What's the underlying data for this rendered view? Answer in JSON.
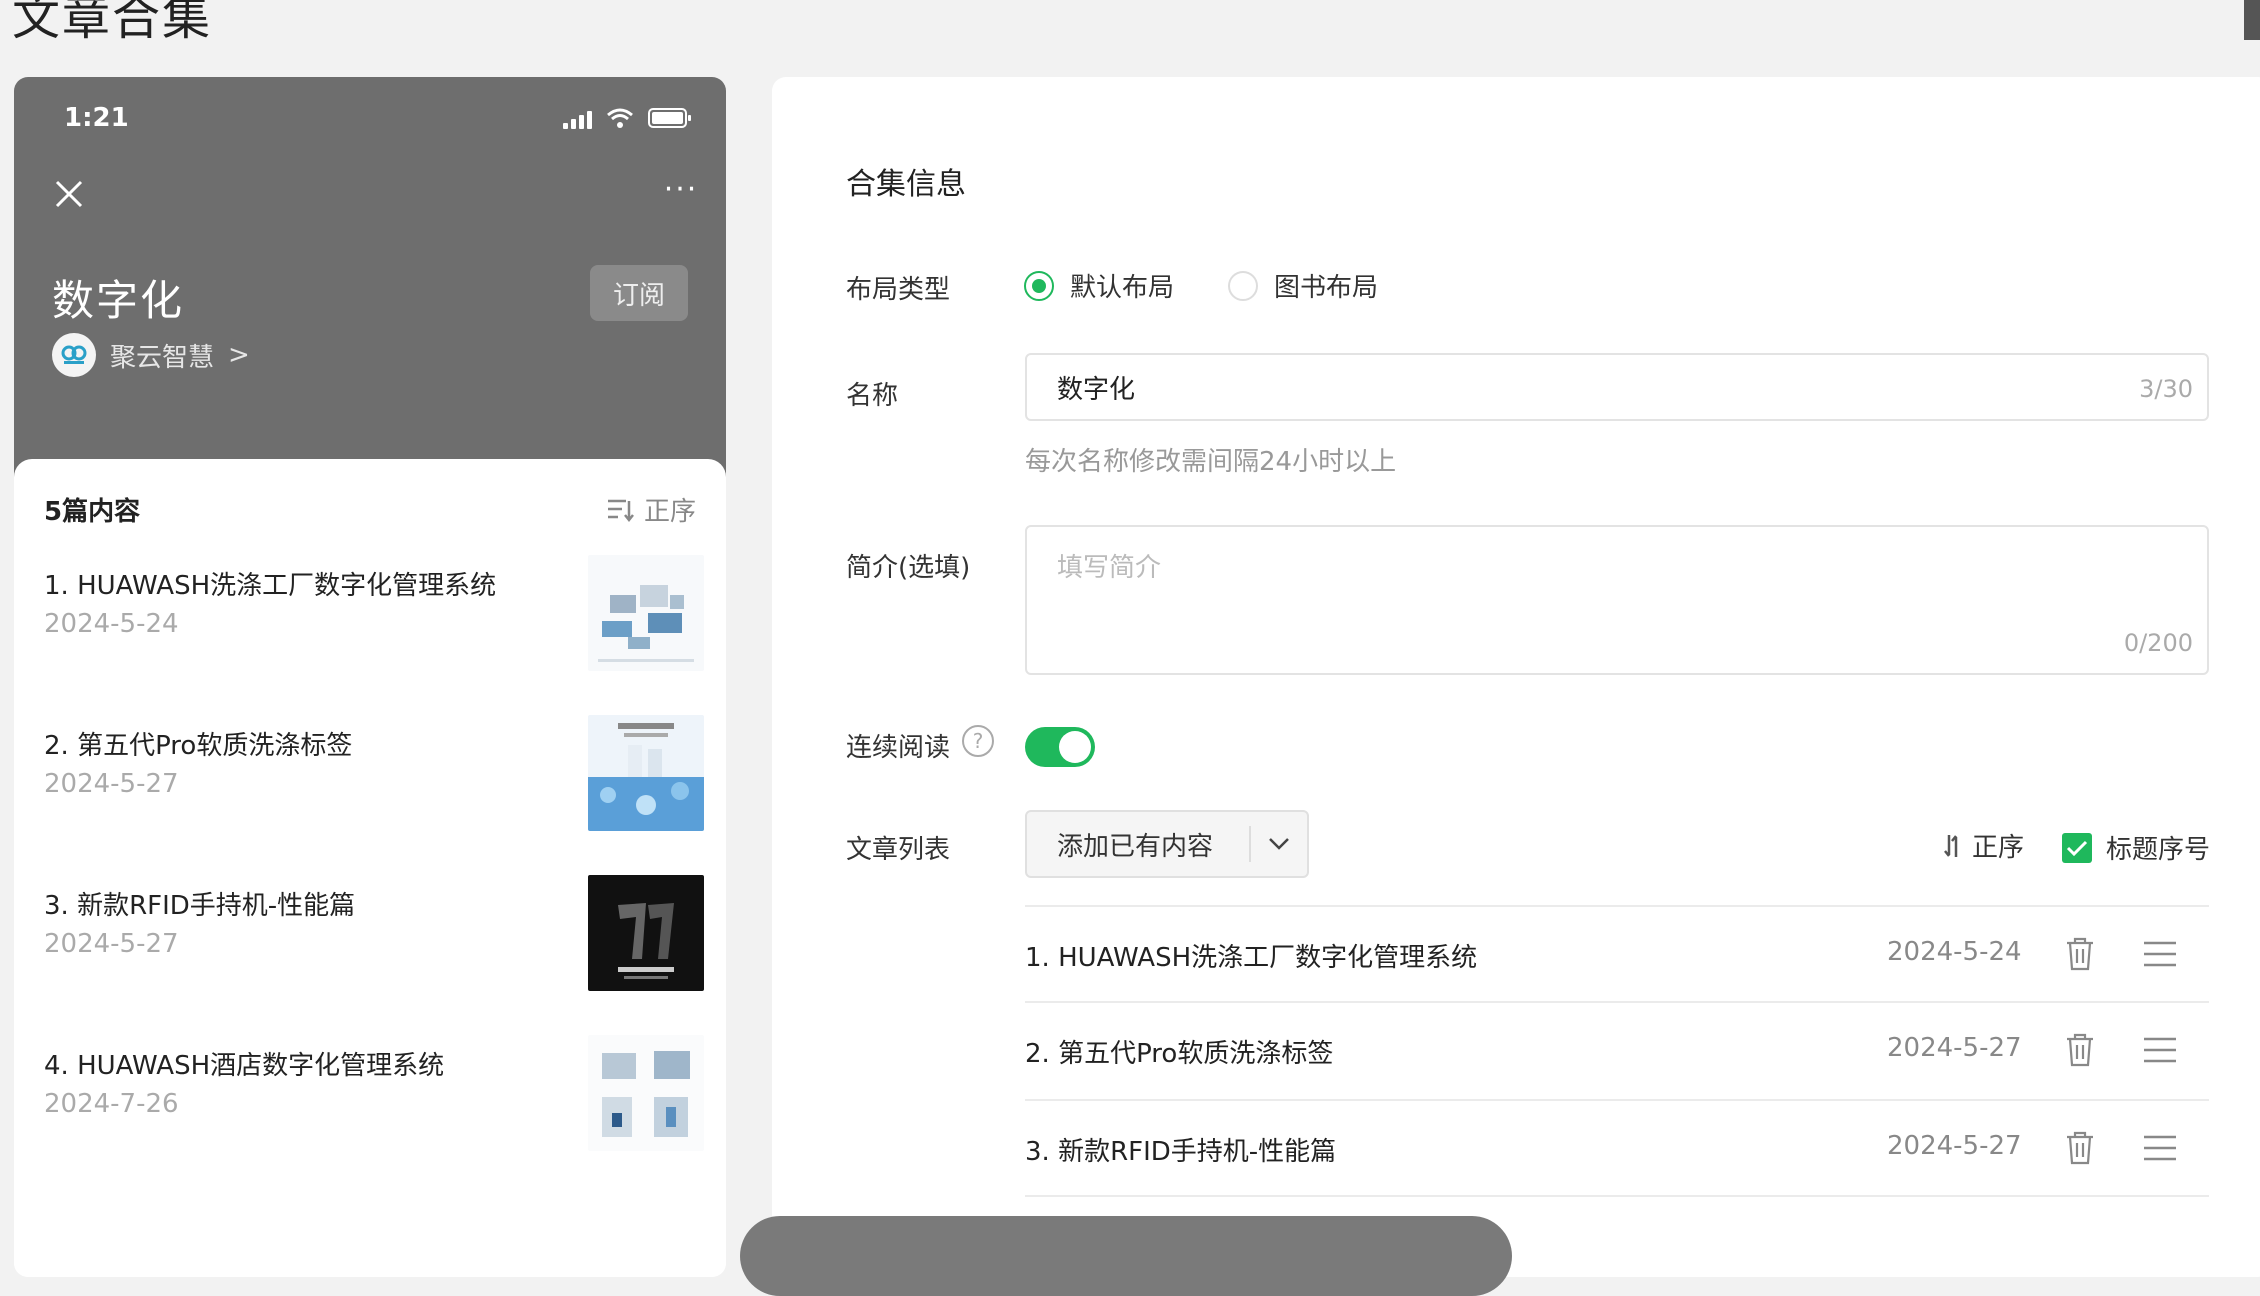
{
  "page": {
    "title": "文章合集"
  },
  "phone": {
    "status_time": "1:21",
    "collection_name": "数字化",
    "subscribe_label": "订阅",
    "author_name": "聚云智慧",
    "author_chevron": ">",
    "more_label": "···",
    "count_label": "5篇内容",
    "order_label": "正序",
    "items": [
      {
        "title": "1. HUAWASH洗涤工厂数字化管理系统",
        "date": "2024-5-24"
      },
      {
        "title": "2. 第五代Pro软质洗涤标签",
        "date": "2024-5-27"
      },
      {
        "title": "3. 新款RFID手持机-性能篇",
        "date": "2024-5-27"
      },
      {
        "title": "4. HUAWASH酒店数字化管理系统",
        "date": "2024-7-26"
      }
    ]
  },
  "panel": {
    "section_title": "合集信息",
    "layout": {
      "label": "布局类型",
      "options": [
        {
          "label": "默认布局",
          "selected": true
        },
        {
          "label": "图书布局",
          "selected": false
        }
      ]
    },
    "name": {
      "label": "名称",
      "value": "数字化",
      "counter": "3/30",
      "hint": "每次名称修改需间隔24小时以上"
    },
    "intro": {
      "label": "简介(选填)",
      "placeholder": "填写简介",
      "counter": "0/200"
    },
    "continuous": {
      "label": "连续阅读",
      "help": "?",
      "enabled": true
    },
    "articles": {
      "label": "文章列表",
      "add_label": "添加已有内容",
      "order_label": "正序",
      "numbering_label": "标题序号",
      "numbering_checked": true,
      "rows": [
        {
          "title": "1. HUAWASH洗涤工厂数字化管理系统",
          "date": "2024-5-24"
        },
        {
          "title": "2. 第五代Pro软质洗涤标签",
          "date": "2024-5-27"
        },
        {
          "title": "3. 新款RFID手持机-性能篇",
          "date": "2024-5-27"
        }
      ]
    }
  },
  "colors": {
    "accent": "#1fb85c",
    "phone_header": "#6e6e6e"
  }
}
